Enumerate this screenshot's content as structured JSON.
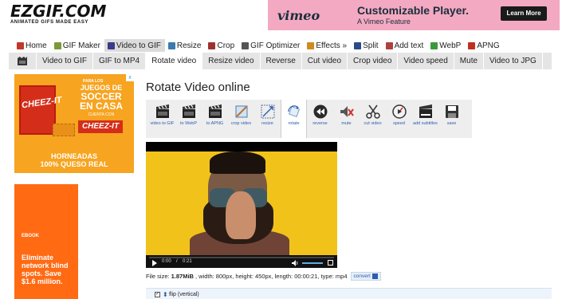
{
  "logo": {
    "text": "EZGIF.COM",
    "tagline": "ANIMATED GIFS MADE EASY"
  },
  "top_ad": {
    "brand": "vimeo",
    "headline": "Customizable Player.",
    "subline": "A Vimeo Feature",
    "cta": "Learn More"
  },
  "main_nav": [
    {
      "label": "Home",
      "icon": "home-icon",
      "color": "#c0392b"
    },
    {
      "label": "GIF Maker",
      "icon": "gif-maker-icon",
      "color": "#7a9a3a"
    },
    {
      "label": "Video to GIF",
      "icon": "film-icon",
      "color": "#3a3a8a"
    },
    {
      "label": "Resize",
      "icon": "resize-icon",
      "color": "#3a7ab0"
    },
    {
      "label": "Crop",
      "icon": "crop-icon",
      "color": "#a03030"
    },
    {
      "label": "GIF Optimizer",
      "icon": "optimizer-icon",
      "color": "#555555"
    },
    {
      "label": "Effects »",
      "icon": "effects-icon",
      "color": "#d08a20"
    },
    {
      "label": "Split",
      "icon": "split-icon",
      "color": "#2a4a8a"
    },
    {
      "label": "Add text",
      "icon": "text-icon",
      "color": "#b04040"
    },
    {
      "label": "WebP",
      "icon": "webp-icon",
      "color": "#3a9a3a"
    },
    {
      "label": "APNG",
      "icon": "apng-icon",
      "color": "#c03020"
    }
  ],
  "sub_nav": {
    "first_icon": "film-strip-icon",
    "items": [
      "Video to GIF",
      "GIF to MP4",
      "Rotate video",
      "Resize video",
      "Reverse",
      "Cut video",
      "Crop video",
      "Video speed",
      "Mute",
      "Video to JPG"
    ],
    "active": "Rotate video"
  },
  "ad1": {
    "brand": "CHEEZ-IT",
    "box_text": "CHEEZ-IT",
    "para": "PARA LOS",
    "juegos": "JUEGOS DE",
    "soccer": "SOCCER",
    "casa": "EN CASA",
    "cuenta": "CUENTA CON",
    "horneadas": "HORNEADAS",
    "queso": "100% QUESO REAL",
    "close": "x"
  },
  "ad2": {
    "label": "EBOOK",
    "message": "Eliminate network blind spots. Save $1.6 million."
  },
  "page_title": "Rotate Video online",
  "tools": [
    {
      "label": "video to GIF",
      "icon": "clapperboard-icon"
    },
    {
      "label": "to WebP",
      "icon": "clapperboard-icon"
    },
    {
      "label": "to APNG",
      "icon": "clapperboard-icon"
    },
    {
      "label": "crop video",
      "icon": "crop-icon"
    },
    {
      "label": "resize",
      "icon": "resize-icon"
    },
    {
      "label": "rotate",
      "icon": "rotate-icon"
    },
    {
      "label": "reverse",
      "icon": "rewind-icon"
    },
    {
      "label": "mute",
      "icon": "mute-icon"
    },
    {
      "label": "cut video",
      "icon": "scissors-icon"
    },
    {
      "label": "speed",
      "icon": "speed-icon"
    },
    {
      "label": "add subtitles",
      "icon": "subtitles-icon"
    },
    {
      "label": "save",
      "icon": "save-icon"
    }
  ],
  "active_tool": "rotate",
  "video": {
    "time_current": "0:00",
    "time_total": "0:21"
  },
  "file_info": {
    "label_size": "File size:",
    "size": "1.87MiB",
    "details": ", width: 800px, height: 450px, length: 00:00:21, type: mp4",
    "convert": "convert"
  },
  "option": {
    "label": "flip (vertical)",
    "checked": true
  }
}
